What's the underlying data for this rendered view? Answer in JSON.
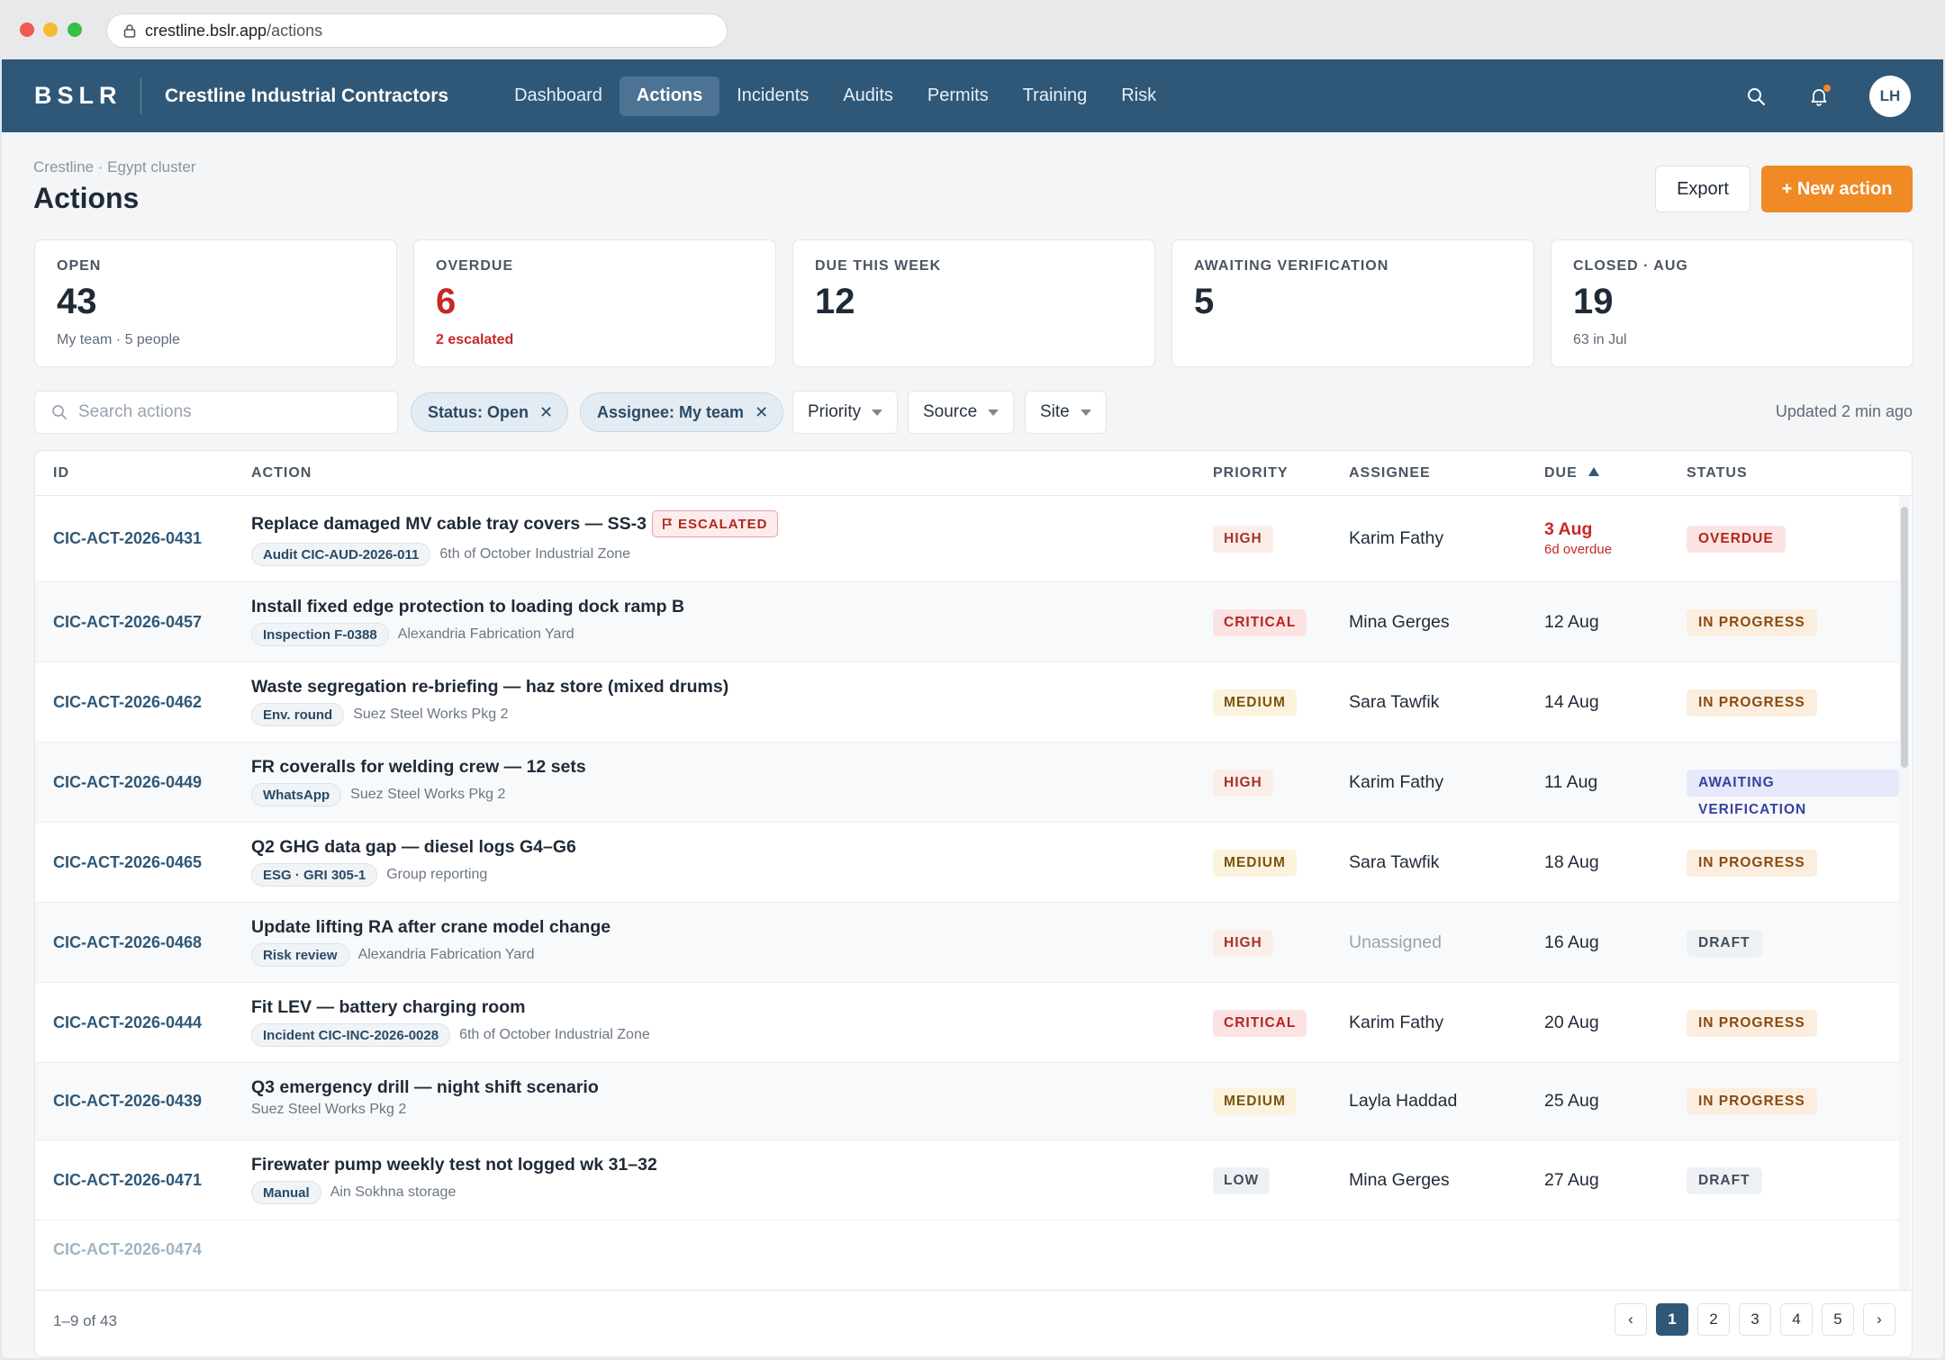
{
  "browser": {
    "url_host": "crestline.bslr.app",
    "url_path": "/actions"
  },
  "nav": {
    "logo": "BSLR",
    "org": "Crestline Industrial Contractors",
    "links": [
      "Dashboard",
      "Actions",
      "Incidents",
      "Audits",
      "Permits",
      "Training",
      "Risk"
    ],
    "active": "Actions",
    "avatar_initials": "LH"
  },
  "page": {
    "breadcrumb": "Crestline · Egypt cluster",
    "title": "Actions",
    "export_label": "Export",
    "new_label": "+ New action"
  },
  "kpis": [
    {
      "label": "OPEN",
      "value": "43",
      "sub": "My team · 5 people"
    },
    {
      "label": "OVERDUE",
      "value": "6",
      "sub": "2 escalated"
    },
    {
      "label": "DUE THIS WEEK",
      "value": "12",
      "sub": ""
    },
    {
      "label": "AWAITING VERIFICATION",
      "value": "5",
      "sub": ""
    },
    {
      "label": "CLOSED · AUG",
      "value": "19",
      "sub": "63 in Jul"
    }
  ],
  "filters": {
    "search_placeholder": "Search actions",
    "chips": [
      "Status: Open",
      "Assignee: My team"
    ],
    "dropdowns": [
      "Priority",
      "Source",
      "Site"
    ],
    "updated": "Updated 2 min ago"
  },
  "table": {
    "headers": {
      "id": "ID",
      "action": "ACTION",
      "priority": "PRIORITY",
      "assignee": "ASSIGNEE",
      "due": "DUE",
      "status": "STATUS"
    },
    "rows": [
      {
        "id": "CIC-ACT-2026-0431",
        "title": "Replace damaged MV cable tray covers — SS-3",
        "escalated": "ESCALATED",
        "source": "Audit CIC-AUD-2026-011",
        "site": "6th of October Industrial Zone",
        "priority": "HIGH",
        "assignee": "Karim Fathy",
        "due": "3 Aug",
        "due_sub": "6d overdue",
        "status": "OVERDUE"
      },
      {
        "id": "CIC-ACT-2026-0457",
        "title": "Install fixed edge protection to loading dock ramp B",
        "source": "Inspection F-0388",
        "site": "Alexandria Fabrication Yard",
        "priority": "CRITICAL",
        "assignee": "Mina Gerges",
        "due": "12 Aug",
        "status": "IN PROGRESS"
      },
      {
        "id": "CIC-ACT-2026-0462",
        "title": "Waste segregation re-briefing — haz store (mixed drums)",
        "source": "Env. round",
        "site": "Suez Steel Works Pkg 2",
        "priority": "MEDIUM",
        "assignee": "Sara Tawfik",
        "due": "14 Aug",
        "status": "IN PROGRESS"
      },
      {
        "id": "CIC-ACT-2026-0449",
        "title": "FR coveralls for welding crew — 12 sets",
        "source": "WhatsApp",
        "site": "Suez Steel Works Pkg 2",
        "priority": "HIGH",
        "assignee": "Karim Fathy",
        "due": "11 Aug",
        "status": "AWAITING VERIFICATION"
      },
      {
        "id": "CIC-ACT-2026-0465",
        "title": "Q2 GHG data gap — diesel logs G4–G6",
        "source": "ESG · GRI 305-1",
        "site": "Group reporting",
        "priority": "MEDIUM",
        "assignee": "Sara Tawfik",
        "due": "18 Aug",
        "status": "IN PROGRESS"
      },
      {
        "id": "CIC-ACT-2026-0468",
        "title": "Update lifting RA after crane model change",
        "source": "Risk review",
        "site": "Alexandria Fabrication Yard",
        "priority": "HIGH",
        "assignee": "Unassigned",
        "due": "16 Aug",
        "status": "DRAFT"
      },
      {
        "id": "CIC-ACT-2026-0444",
        "title": "Fit LEV — battery charging room",
        "source": "Incident CIC-INC-2026-0028",
        "site": "6th of October Industrial Zone",
        "priority": "CRITICAL",
        "assignee": "Karim Fathy",
        "due": "20 Aug",
        "status": "IN PROGRESS"
      },
      {
        "id": "CIC-ACT-2026-0439",
        "title": "Q3 emergency drill — night shift scenario",
        "source": "",
        "site": "Suez Steel Works Pkg 2",
        "priority": "MEDIUM",
        "assignee": "Layla Haddad",
        "due": "25 Aug",
        "status": "IN PROGRESS"
      },
      {
        "id": "CIC-ACT-2026-0471",
        "title": "Firewater pump weekly test not logged wk 31–32",
        "source": "Manual",
        "site": "Ain Sokhna storage",
        "priority": "LOW",
        "assignee": "Mina Gerges",
        "due": "27 Aug",
        "status": "DRAFT"
      }
    ],
    "partial_row_id": "CIC-ACT-2026-0474",
    "count_label": "1–9 of 43",
    "pages": [
      "‹",
      "1",
      "2",
      "3",
      "4",
      "5",
      "›"
    ],
    "current_page": "1"
  }
}
